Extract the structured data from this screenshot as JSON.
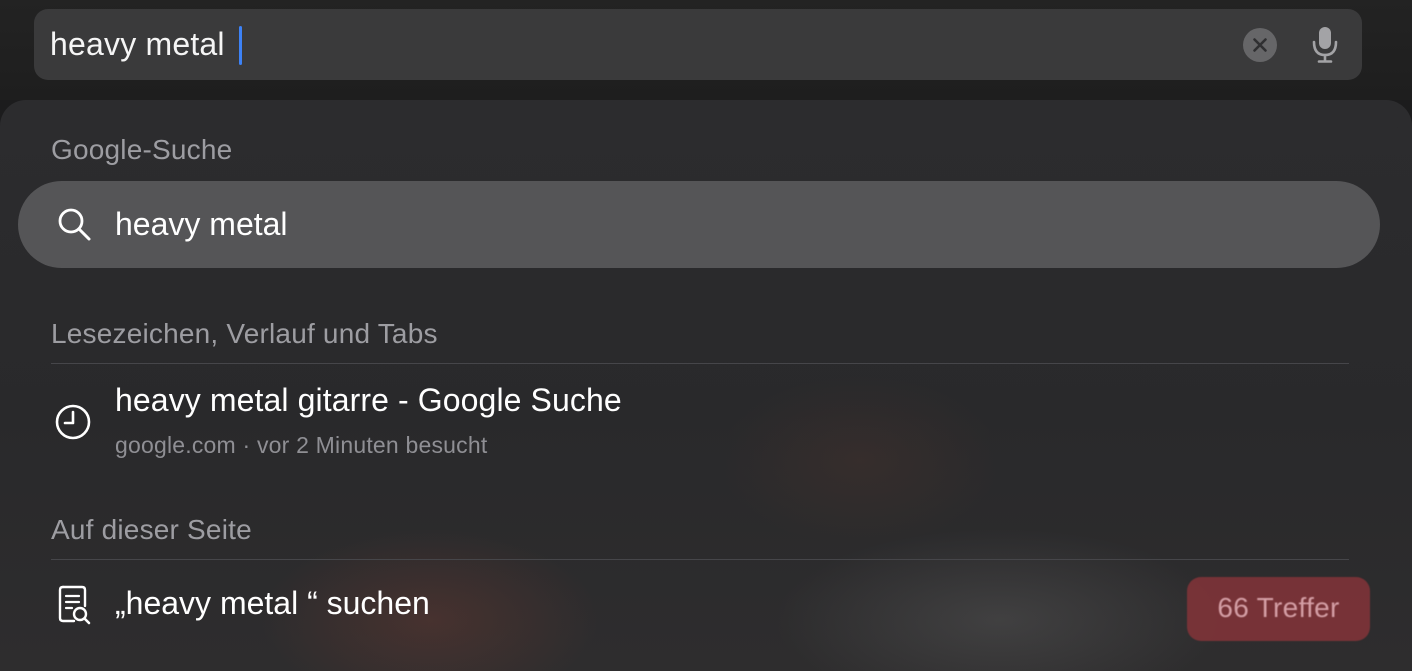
{
  "search": {
    "value": "heavy metal"
  },
  "google_section": {
    "header": "Google-Suche",
    "suggestion": "heavy metal"
  },
  "history_section": {
    "header": "Lesezeichen, Verlauf und Tabs",
    "items": [
      {
        "title": "heavy metal gitarre - Google Suche",
        "subtitle": "google.com · vor 2 Minuten besucht",
        "icon": "clock-icon"
      }
    ]
  },
  "page_section": {
    "header": "Auf dieser Seite",
    "find_label": "„heavy metal “ suchen",
    "match_count": "66 Treffer",
    "icon": "find-in-page-icon"
  },
  "colors": {
    "cursor": "#3d82f6",
    "badge": "#8c343a",
    "selected_row": "#555557"
  }
}
